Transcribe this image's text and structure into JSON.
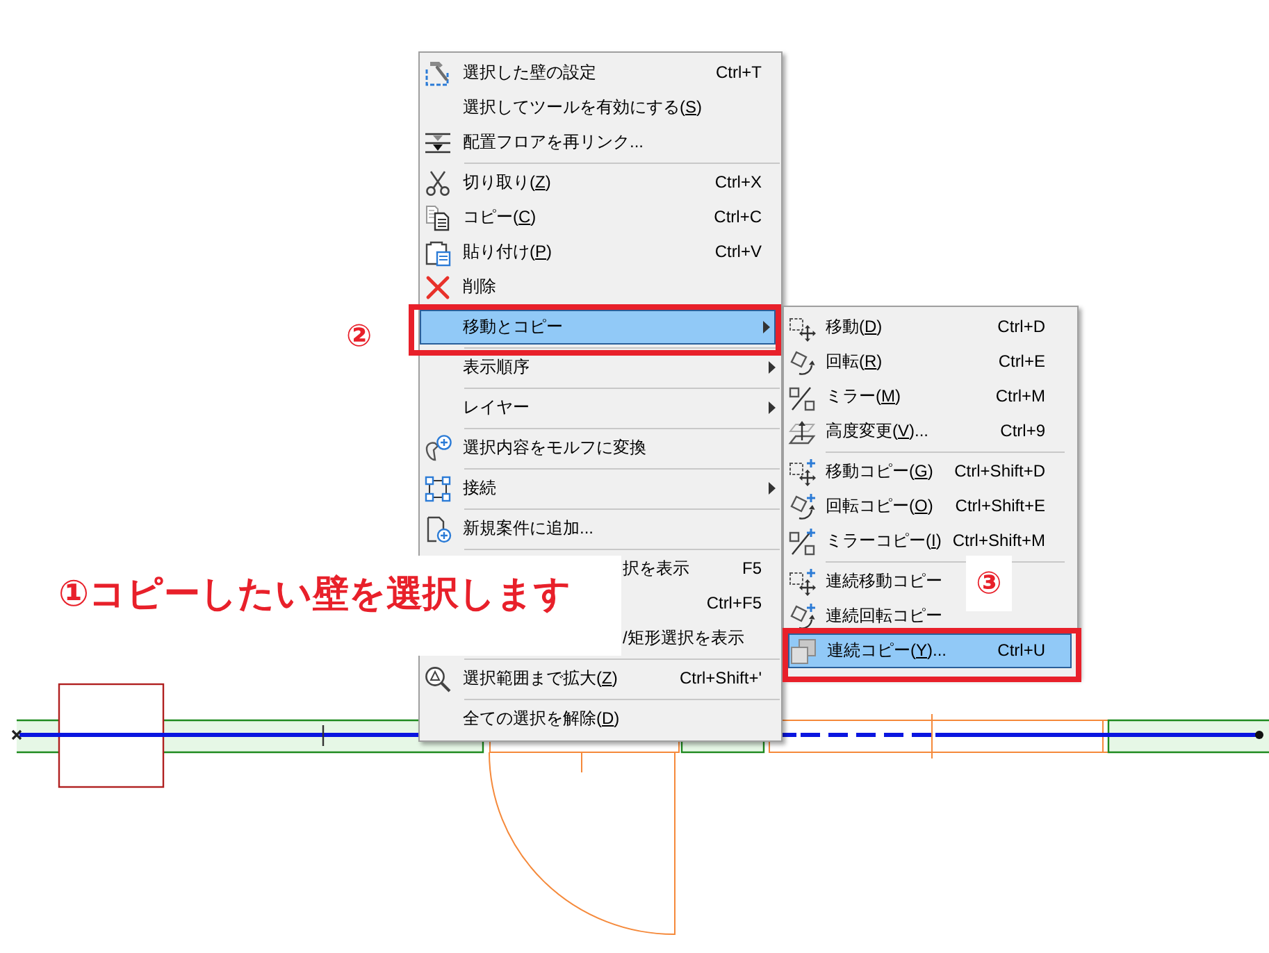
{
  "context_menu": {
    "items": [
      {
        "kind": "item",
        "label": "選択した壁の設定",
        "shortcut": "Ctrl+T",
        "submenu": false,
        "selected": false
      },
      {
        "kind": "item",
        "label": "選択してツールを有効にする(",
        "access_key": "S",
        "label_end": ")",
        "submenu": false,
        "selected": false
      },
      {
        "kind": "item",
        "label": "配置フロアを再リンク...",
        "submenu": false,
        "selected": false
      },
      {
        "kind": "separator"
      },
      {
        "kind": "item",
        "label": "切り取り(",
        "access_key": "Z",
        "label_end": ")",
        "shortcut": "Ctrl+X",
        "submenu": false,
        "selected": false
      },
      {
        "kind": "item",
        "label": "コピー(",
        "access_key": "C",
        "label_end": ")",
        "shortcut": "Ctrl+C",
        "submenu": false,
        "selected": false
      },
      {
        "kind": "item",
        "label": "貼り付け(",
        "access_key": "P",
        "label_end": ")",
        "shortcut": "Ctrl+V",
        "submenu": false,
        "selected": false
      },
      {
        "kind": "item",
        "label": "削除",
        "submenu": false,
        "selected": false
      },
      {
        "kind": "separator"
      },
      {
        "kind": "item",
        "label": "移動とコピー",
        "submenu": true,
        "selected": true
      },
      {
        "kind": "separator"
      },
      {
        "kind": "item",
        "label": "表示順序",
        "submenu": true,
        "selected": false
      },
      {
        "kind": "separator"
      },
      {
        "kind": "item",
        "label": "レイヤー",
        "submenu": true,
        "selected": false
      },
      {
        "kind": "separator"
      },
      {
        "kind": "item",
        "label": "選択内容をモルフに変換",
        "submenu": false,
        "selected": false
      },
      {
        "kind": "separator"
      },
      {
        "kind": "item",
        "label": "接続",
        "submenu": true,
        "selected": false
      },
      {
        "kind": "separator"
      },
      {
        "kind": "item",
        "label": "新規案件に追加...",
        "submenu": false,
        "selected": false
      },
      {
        "kind": "separator"
      },
      {
        "kind": "partial",
        "label": "択を表示",
        "shortcut": "F5",
        "submenu": false,
        "selected": false
      },
      {
        "kind": "partial",
        "shortcut": "Ctrl+F5",
        "submenu": false,
        "selected": false
      },
      {
        "kind": "partial",
        "label": "/矩形選択を表示",
        "submenu": false,
        "selected": false
      },
      {
        "kind": "separator"
      },
      {
        "kind": "item",
        "label": "選択範囲まで拡大(",
        "access_key": "Z",
        "label_end": ")",
        "shortcut": "Ctrl+Shift+'",
        "submenu": false,
        "selected": false
      },
      {
        "kind": "separator"
      },
      {
        "kind": "item",
        "label": "全ての選択を解除(",
        "access_key": "D",
        "label_end": ")",
        "submenu": false,
        "selected": false
      }
    ]
  },
  "submenu": {
    "items": [
      {
        "kind": "item",
        "label": "移動(",
        "access_key": "D",
        "label_end": ")",
        "shortcut": "Ctrl+D",
        "selected": false
      },
      {
        "kind": "item",
        "label": "回転(",
        "access_key": "R",
        "label_end": ")",
        "shortcut": "Ctrl+E",
        "selected": false
      },
      {
        "kind": "item",
        "label": "ミラー(",
        "access_key": "M",
        "label_end": ")",
        "shortcut": "Ctrl+M",
        "selected": false
      },
      {
        "kind": "item",
        "label": "高度変更(",
        "access_key": "V",
        "label_end": ")...",
        "shortcut": "Ctrl+9",
        "selected": false
      },
      {
        "kind": "separator"
      },
      {
        "kind": "item",
        "label": "移動コピー(",
        "access_key": "G",
        "label_end": ")",
        "shortcut": "Ctrl+Shift+D",
        "selected": false
      },
      {
        "kind": "item",
        "label": "回転コピー(",
        "access_key": "O",
        "label_end": ")",
        "shortcut": "Ctrl+Shift+E",
        "selected": false
      },
      {
        "kind": "item",
        "label": "ミラーコピー(",
        "access_key": "I",
        "label_end": ")",
        "shortcut": "Ctrl+Shift+M",
        "selected": false
      },
      {
        "kind": "separator"
      },
      {
        "kind": "item",
        "label": "連続移動コピー",
        "selected": false
      },
      {
        "kind": "item",
        "label": "連続回転コピー",
        "selected": false
      },
      {
        "kind": "item",
        "label": "連続コピー(",
        "access_key": "Y",
        "label_end": ")...",
        "shortcut": "Ctrl+U",
        "selected": true
      }
    ]
  },
  "callouts": [
    {
      "kind": "instruction",
      "text": "①コピーしたい壁を選択します"
    },
    {
      "kind": "step",
      "text": "②"
    },
    {
      "kind": "step",
      "text": "③"
    }
  ]
}
